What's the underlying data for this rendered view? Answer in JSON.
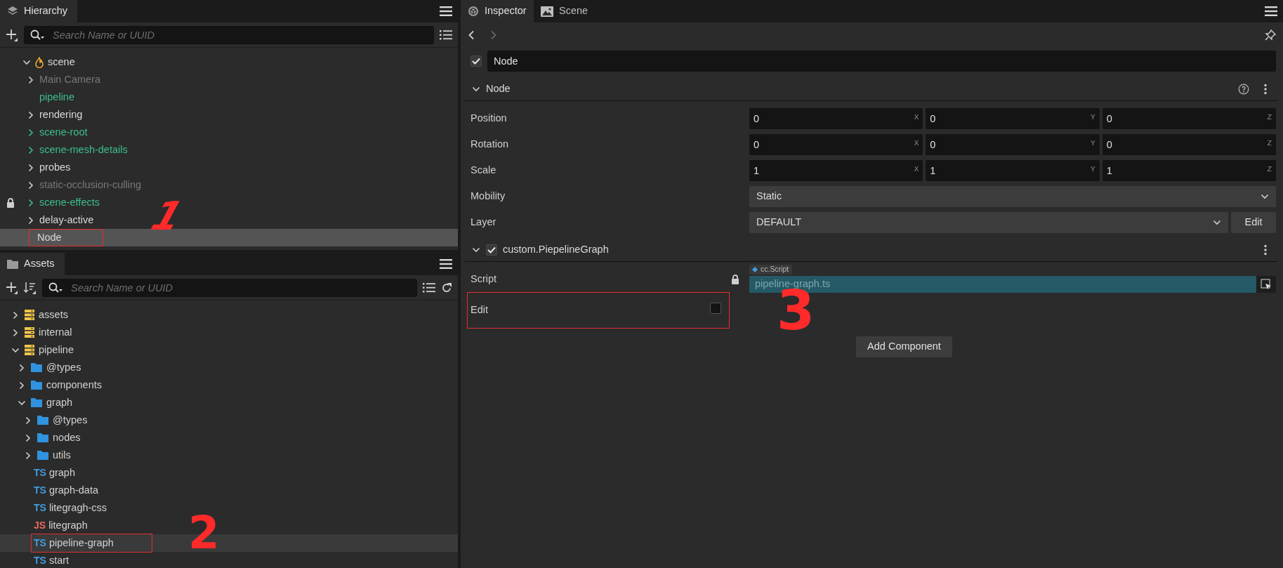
{
  "hierarchy": {
    "title": "Hierarchy",
    "search": {
      "placeholder": "Search Name or UUID"
    },
    "tree": [
      {
        "label": "scene",
        "kind": "scene",
        "expanded": true,
        "locked": false,
        "selected": false,
        "children": [
          {
            "label": "Main Camera",
            "kind": "inactive",
            "expanded": false,
            "locked": false,
            "selected": false
          },
          {
            "label": "pipeline",
            "kind": "prefab",
            "locked": false,
            "selected": false
          },
          {
            "label": "rendering",
            "kind": "node",
            "expanded": false,
            "locked": false,
            "selected": false
          },
          {
            "label": "scene-root",
            "kind": "prefab",
            "expanded": false,
            "locked": false,
            "selected": false
          },
          {
            "label": "scene-mesh-details",
            "kind": "prefab",
            "expanded": false,
            "locked": false,
            "selected": false
          },
          {
            "label": "probes",
            "kind": "node",
            "expanded": false,
            "locked": false,
            "selected": false
          },
          {
            "label": "static-occlusion-culling",
            "kind": "inactive",
            "expanded": false,
            "locked": false,
            "selected": false
          },
          {
            "label": "scene-effects",
            "kind": "prefab",
            "expanded": false,
            "locked": true,
            "selected": false
          },
          {
            "label": "delay-active",
            "kind": "node",
            "expanded": false,
            "locked": false,
            "selected": false
          },
          {
            "label": "Node",
            "kind": "node",
            "locked": false,
            "selected": true,
            "annotated": true,
            "note": "1"
          }
        ]
      }
    ]
  },
  "assets": {
    "title": "Assets",
    "search": {
      "placeholder": "Search Name or UUID"
    },
    "tree": [
      {
        "label": "assets",
        "kind": "database",
        "expanded": false,
        "selected": false
      },
      {
        "label": "internal",
        "kind": "database",
        "expanded": false,
        "selected": false
      },
      {
        "label": "pipeline",
        "kind": "database",
        "expanded": true,
        "selected": false,
        "children": [
          {
            "label": "@types",
            "kind": "folder",
            "expanded": false,
            "selected": false
          },
          {
            "label": "components",
            "kind": "folder",
            "expanded": false,
            "selected": false
          },
          {
            "label": "graph",
            "kind": "folder",
            "expanded": true,
            "selected": false,
            "children": [
              {
                "label": "@types",
                "kind": "folder",
                "expanded": false,
                "selected": false
              },
              {
                "label": "nodes",
                "kind": "folder",
                "expanded": false,
                "selected": false
              },
              {
                "label": "utils",
                "kind": "folder",
                "expanded": false,
                "selected": false
              },
              {
                "label": "graph",
                "kind": "ts",
                "tag": "TS",
                "selected": false
              },
              {
                "label": "graph-data",
                "kind": "ts",
                "tag": "TS",
                "selected": false
              },
              {
                "label": "litegragh-css",
                "kind": "ts",
                "tag": "TS",
                "selected": false
              },
              {
                "label": "litegraph",
                "kind": "js",
                "tag": "JS",
                "selected": false
              },
              {
                "label": "pipeline-graph",
                "kind": "ts",
                "tag": "TS",
                "selected": true,
                "annotated": true,
                "note": "2"
              },
              {
                "label": "start",
                "kind": "ts",
                "tag": "TS",
                "selected": false
              }
            ]
          }
        ]
      }
    ]
  },
  "inspector": {
    "tabs": [
      {
        "label": "Inspector",
        "kind": "inspector",
        "selected": true
      },
      {
        "label": "Scene",
        "kind": "scene",
        "selected": false
      }
    ],
    "node": {
      "active": true,
      "name": "Node"
    },
    "sections": [
      {
        "title": "Node",
        "expanded": true,
        "help": true,
        "properties": [
          {
            "label": "Position",
            "kind": "vec3",
            "fields": [
              {
                "value": "0",
                "axis": "X"
              },
              {
                "value": "0",
                "axis": "Y"
              },
              {
                "value": "0",
                "axis": "Z"
              }
            ]
          },
          {
            "label": "Rotation",
            "kind": "vec3",
            "fields": [
              {
                "value": "0",
                "axis": "X"
              },
              {
                "value": "0",
                "axis": "Y"
              },
              {
                "value": "0",
                "axis": "Z"
              }
            ]
          },
          {
            "label": "Scale",
            "kind": "vec3",
            "fields": [
              {
                "value": "1",
                "axis": "X"
              },
              {
                "value": "1",
                "axis": "Y"
              },
              {
                "value": "1",
                "axis": "Z"
              }
            ]
          },
          {
            "label": "Mobility",
            "kind": "select",
            "value": "Static"
          },
          {
            "label": "Layer",
            "kind": "select",
            "value": "DEFAULT",
            "button": "Edit"
          }
        ]
      },
      {
        "title": "custom.PiepelineGraph",
        "expanded": true,
        "help": false,
        "checked": true,
        "properties": [
          {
            "label": "Script",
            "kind": "asset",
            "locked": true,
            "type_tag": "cc.Script",
            "value": "pipeline-graph.ts"
          },
          {
            "label": "Edit",
            "kind": "checkbox",
            "checked": false,
            "annotated": true,
            "note": "3"
          }
        ]
      }
    ],
    "add_button": "Add Component"
  }
}
